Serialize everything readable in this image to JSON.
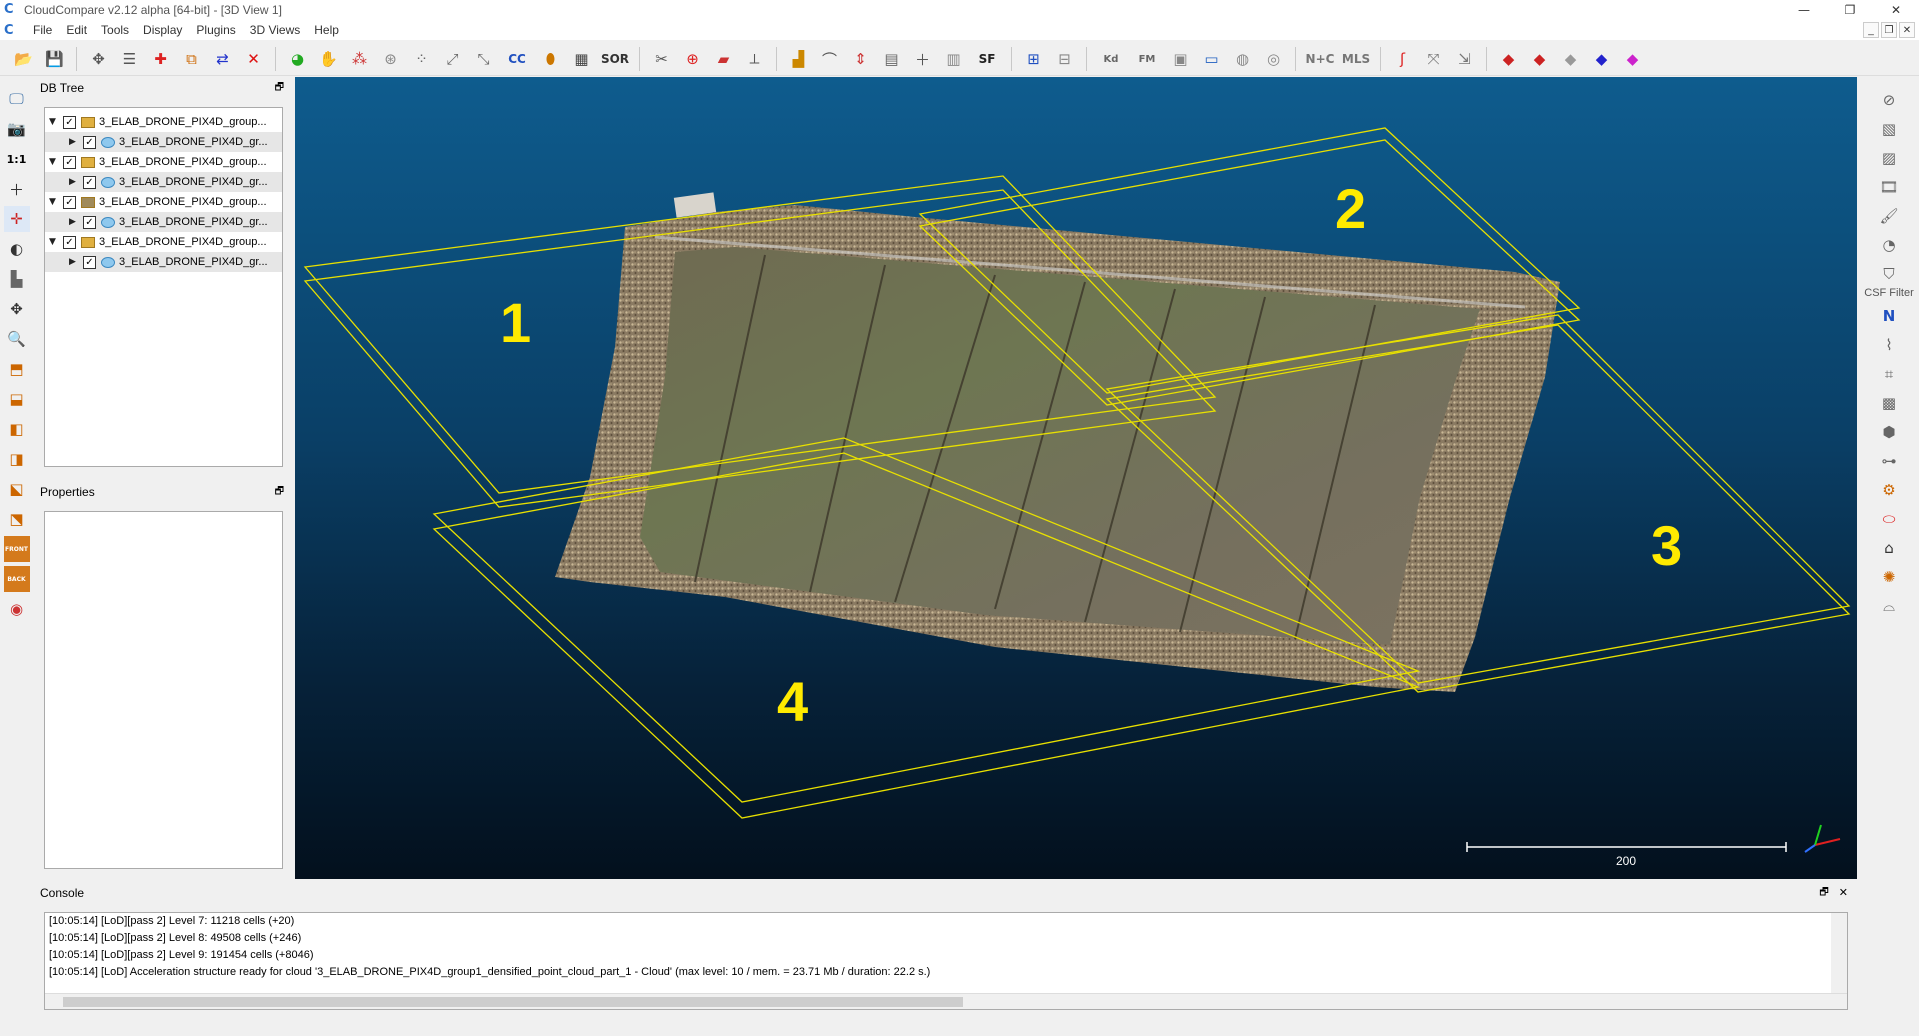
{
  "window": {
    "title": "CloudCompare v2.12 alpha [64-bit] - [3D View 1]",
    "app_glyph": "C",
    "minimize_glyph": "—",
    "restore_glyph": "❐",
    "close_glyph": "✕"
  },
  "menu": {
    "items": [
      "File",
      "Edit",
      "Tools",
      "Display",
      "Plugins",
      "3D Views",
      "Help"
    ],
    "mdi_glyphs": [
      "_",
      "❐",
      "✕"
    ]
  },
  "toolbar": {
    "sor_label": "SOR",
    "cc_label": "CC",
    "sf_label": "SF",
    "kd_label": "Kd",
    "fm_label": "FM",
    "nc_label": "N+C",
    "mls_label": "MLS"
  },
  "left_toolbar": {
    "one_to_one_label": "1:1",
    "front_label": "FRONT",
    "back_label": "BACK"
  },
  "right_toolbar": {
    "csf_label": "CSF Filter",
    "north_label": "N"
  },
  "db_tree": {
    "title": "DB Tree",
    "float_glyph": "🗗",
    "items": [
      {
        "label": "3_ELAB_DRONE_PIX4D_group...",
        "type": "group",
        "checked": true,
        "expanded": true
      },
      {
        "label": "3_ELAB_DRONE_PIX4D_gr...",
        "type": "cloud",
        "checked": true,
        "expanded": false
      },
      {
        "label": "3_ELAB_DRONE_PIX4D_group...",
        "type": "group",
        "checked": true,
        "expanded": true
      },
      {
        "label": "3_ELAB_DRONE_PIX4D_gr...",
        "type": "cloud",
        "checked": true,
        "expanded": false
      },
      {
        "label": "3_ELAB_DRONE_PIX4D_group...",
        "type": "group",
        "checked": true,
        "expanded": true
      },
      {
        "label": "3_ELAB_DRONE_PIX4D_gr...",
        "type": "cloud",
        "checked": true,
        "expanded": false
      },
      {
        "label": "3_ELAB_DRONE_PIX4D_group...",
        "type": "group",
        "checked": true,
        "expanded": true
      },
      {
        "label": "3_ELAB_DRONE_PIX4D_gr...",
        "type": "cloud",
        "checked": true,
        "expanded": false
      }
    ]
  },
  "properties": {
    "title": "Properties",
    "float_glyph": "🗗"
  },
  "view3d": {
    "box_labels": [
      "1",
      "2",
      "3",
      "4"
    ],
    "scale_value": "200",
    "box_color": "#e8e000",
    "label_color": "#ffea00"
  },
  "console": {
    "title": "Console",
    "float_glyph": "🗗",
    "close_glyph": "✕",
    "lines": [
      "[10:05:14] [LoD][pass 2] Level 7: 11218 cells (+20)",
      "[10:05:14] [LoD][pass 2] Level 8: 49508 cells (+246)",
      "[10:05:14] [LoD][pass 2] Level 9: 191454 cells (+8046)",
      "[10:05:14] [LoD] Acceleration structure ready for cloud '3_ELAB_DRONE_PIX4D_group1_densified_point_cloud_part_1 - Cloud' (max level: 10 / mem. = 23.71 Mb / duration: 22.2 s.)"
    ]
  }
}
